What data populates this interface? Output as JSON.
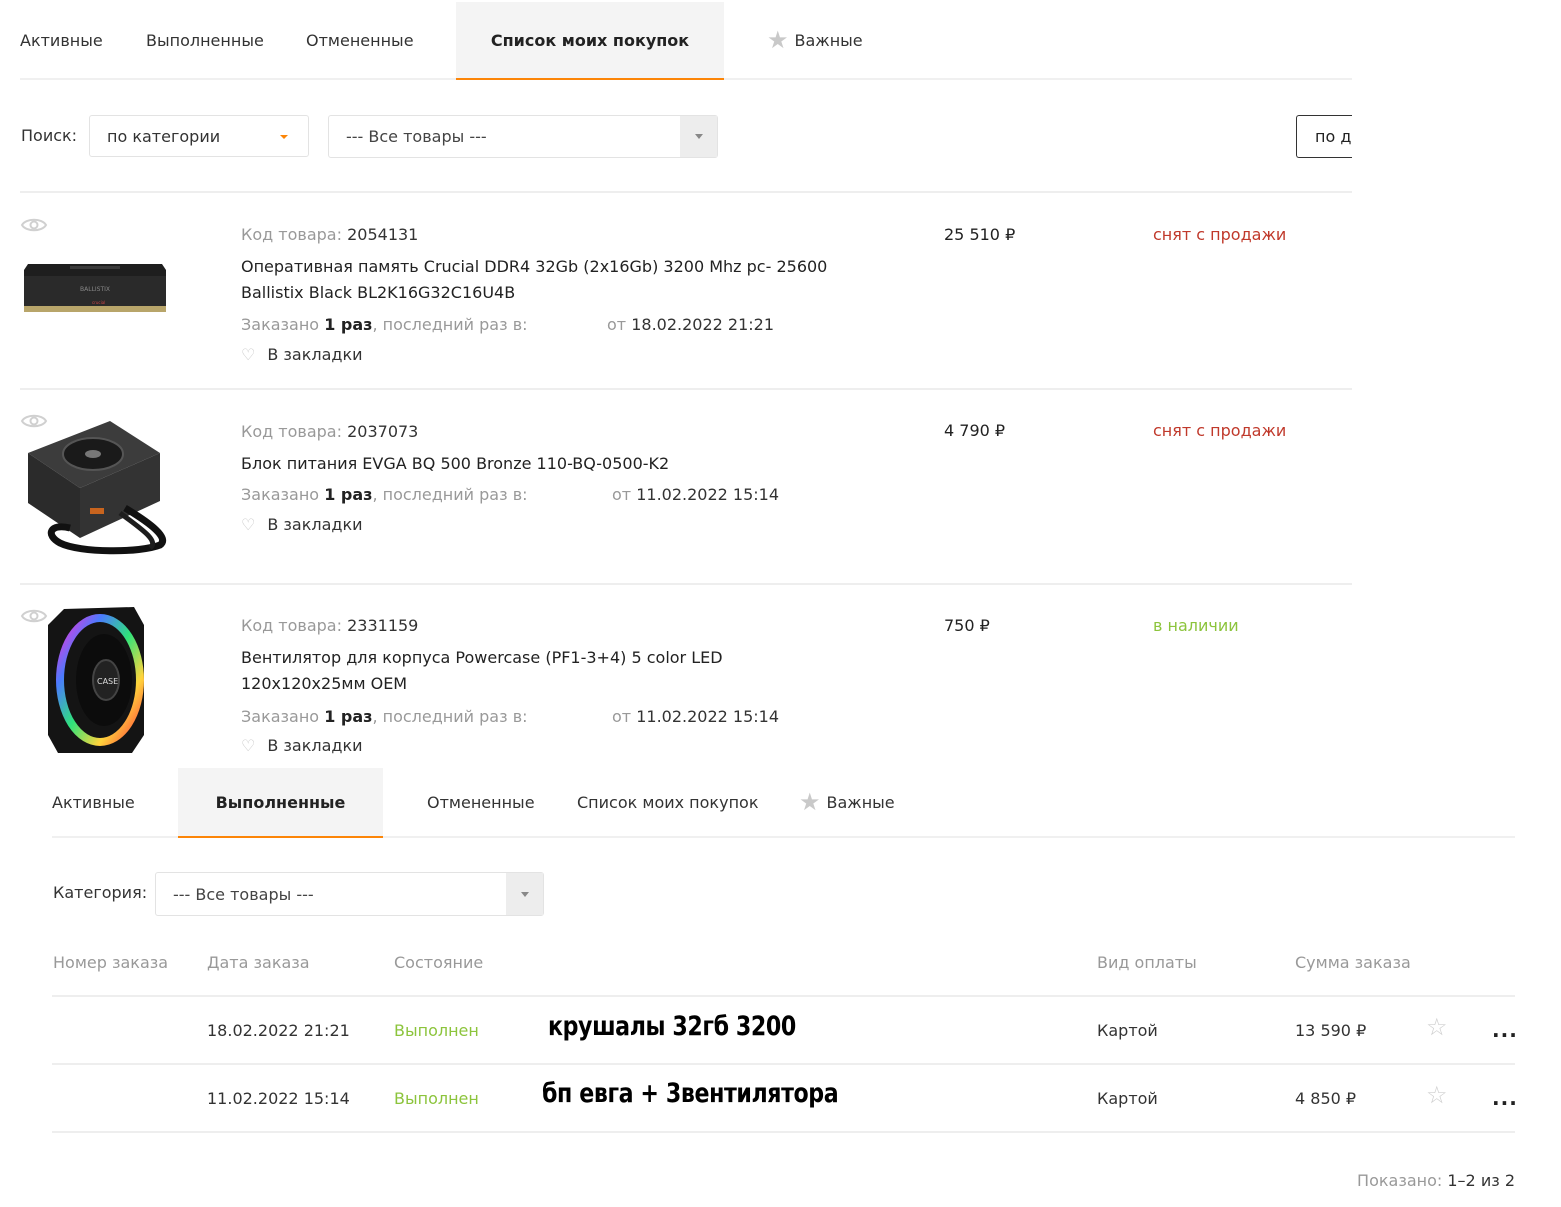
{
  "top_tabs": [
    {
      "label": "Активные"
    },
    {
      "label": "Выполненные"
    },
    {
      "label": "Отмененные"
    },
    {
      "label": "Список моих покупок",
      "active": true
    },
    {
      "label": "Важные",
      "icon": "star-icon"
    }
  ],
  "search": {
    "label": "Поиск:",
    "mode_value": "по категории",
    "category_value": "--- Все товары ---",
    "sort_value": "по да"
  },
  "products": [
    {
      "code_label": "Код товара:",
      "code": "2054131",
      "name": "Оперативная память Crucial DDR4 32Gb (2x16Gb) 3200 Mhz pc- 25600 Ballistix Black BL2K16G32C16U4B",
      "ordered_prefix": "Заказано",
      "ordered_count": "1 раз",
      "ordered_suffix": ", последний раз в:",
      "date_prefix": "от",
      "date": "18.02.2022 21:21",
      "bookmark": "В закладки",
      "price": "25 510 ₽",
      "status": "снят с продажи",
      "status_color": "#c0392b",
      "image": "ram-module-image"
    },
    {
      "code_label": "Код товара:",
      "code": "2037073",
      "name": "Блок питания EVGA BQ 500 Bronze 110-BQ-0500-K2",
      "ordered_prefix": "Заказано",
      "ordered_count": "1 раз",
      "ordered_suffix": ", последний раз в:",
      "date_prefix": "от",
      "date": "11.02.2022 15:14",
      "bookmark": "В закладки",
      "price": "4 790 ₽",
      "status": "снят с продажи",
      "status_color": "#c0392b",
      "image": "power-supply-image"
    },
    {
      "code_label": "Код товара:",
      "code": "2331159",
      "name": "Вентилятор для корпуса Powercase (PF1-3+4) 5 color LED 120x120x25мм OEM",
      "ordered_prefix": "Заказано",
      "ordered_count": "1 раз",
      "ordered_suffix": ", последний раз в:",
      "date_prefix": "от",
      "date": "11.02.2022 15:14",
      "bookmark": "В закладки",
      "price": "750 ₽",
      "status": "в наличии",
      "status_color": "#8cc43c",
      "image": "rgb-fan-image"
    }
  ],
  "orders_tabs": [
    {
      "label": "Активные"
    },
    {
      "label": "Выполненные",
      "active": true
    },
    {
      "label": "Отмененные"
    },
    {
      "label": "Список моих покупок"
    },
    {
      "label": "Важные",
      "icon": "star-icon"
    }
  ],
  "orders_filter": {
    "label": "Категория:",
    "value": "--- Все товары ---"
  },
  "orders_table": {
    "headers": [
      "Номер заказа",
      "Дата заказа",
      "Состояние",
      "Вид оплаты",
      "Сумма заказа"
    ],
    "rows": [
      {
        "number": "",
        "date": "18.02.2022 21:21",
        "state": "Выполнен",
        "note": "крушалы 32гб 3200",
        "payment": "Картой",
        "sum": "13 590 ₽"
      },
      {
        "number": "",
        "date": "11.02.2022 15:14",
        "state": "Выполнен",
        "note": "бп евга + 3вентилятора",
        "payment": "Картой",
        "sum": "4 850 ₽"
      }
    ]
  },
  "footer": {
    "shown_label": "Показано:",
    "shown_value": "1–2 из 2"
  },
  "colors": {
    "accent": "#fc8507",
    "unavailable": "#c0392b",
    "available": "#8cc43c",
    "muted": "#999999"
  }
}
